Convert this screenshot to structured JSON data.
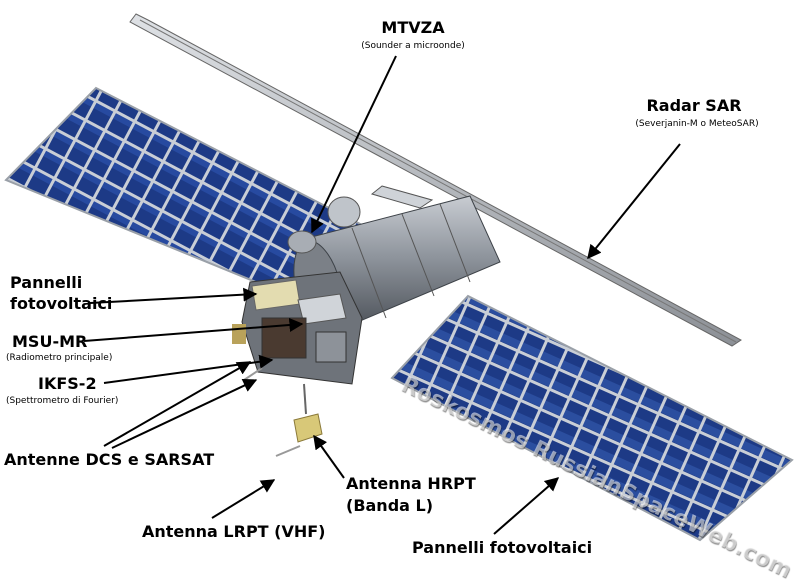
{
  "labels": {
    "mtvza": {
      "title": "MTVZA",
      "subtitle": "(Sounder a microonde)"
    },
    "radar_sar": {
      "title": "Radar SAR",
      "subtitle": "(Severjanin-M o MeteoSAR)"
    },
    "pannelli_left": {
      "line1": "Pannelli",
      "line2": "fotovoltaici"
    },
    "msu_mr": {
      "title": "MSU-MR",
      "subtitle": "(Radiometro principale)"
    },
    "ikfs2": {
      "title": "IKFS-2",
      "subtitle": "(Spettrometro di Fourier)"
    },
    "antenne_dcs": {
      "title": "Antenne DCS e SARSAT"
    },
    "antenna_hrpt": {
      "line1": "Antenna HRPT",
      "line2": "(Banda L)"
    },
    "antenna_lrpt": {
      "title": "Antenna LRPT (VHF)"
    },
    "pannelli_right": {
      "title": "Pannelli fotovoltaici"
    }
  },
  "watermark": "Roskosmos RussianSpaceWeb.com",
  "colors": {
    "panel_cell": "#1d3a86",
    "panel_frame": "#c9ced6",
    "body_metal": "#8e949c",
    "boom": "#b9bec4",
    "gold": "#d8c878",
    "arrow": "#000000"
  },
  "icons": [
    "satellite-illustration",
    "arrow"
  ]
}
